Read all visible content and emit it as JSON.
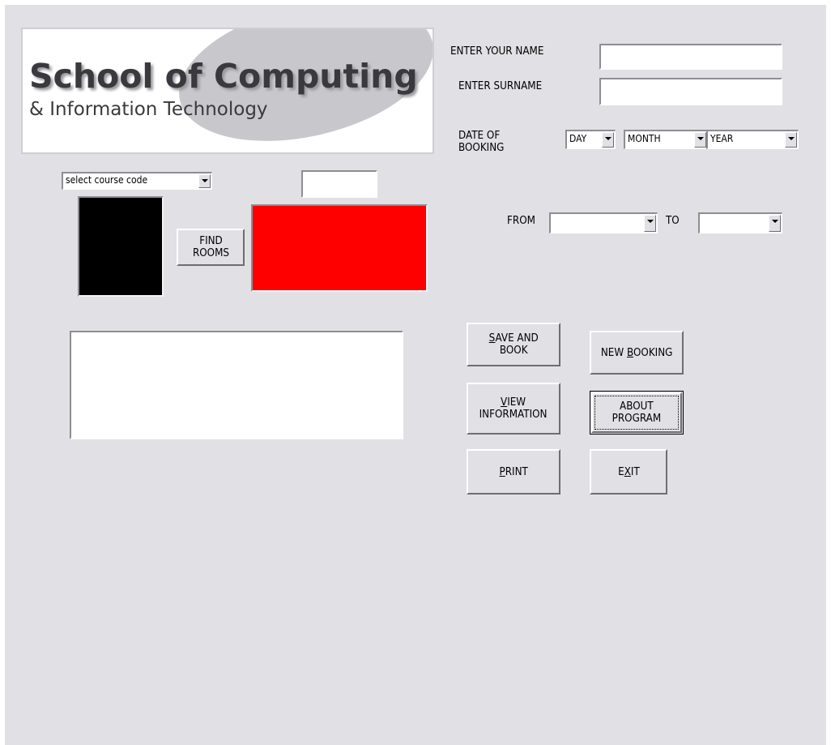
{
  "logo": {
    "title": "School of Computing",
    "subtitle": "& Information Technology"
  },
  "personal": {
    "name_label": "ENTER YOUR NAME",
    "name_value": "",
    "surname_label": "ENTER SURNAME",
    "surname_value": "",
    "date_label": "DATE OF\nBOOKING",
    "day": "DAY",
    "month": "MONTH",
    "year": "YEAR"
  },
  "course": {
    "select_value": "select course code",
    "code_value": "",
    "find_rooms": "FIND\nROOMS"
  },
  "time": {
    "from_label": "FROM",
    "from_value": "",
    "to_label": "TO",
    "to_value": ""
  },
  "colors": {
    "black_panel": "#000000",
    "red_panel": "#ff0000",
    "form_bg": "#e1e0e4"
  },
  "info_box": "",
  "buttons": {
    "save_and_book": [
      "S",
      "AVE AND\nBOOK"
    ],
    "new_booking": [
      "NEW ",
      "B",
      "OOKING"
    ],
    "view_information": [
      "V",
      "IEW\nINFORMATION"
    ],
    "about_program": "ABOUT\nPROGRAM",
    "print": [
      "P",
      "RINT"
    ],
    "exit": [
      "E",
      "X",
      "IT"
    ]
  }
}
